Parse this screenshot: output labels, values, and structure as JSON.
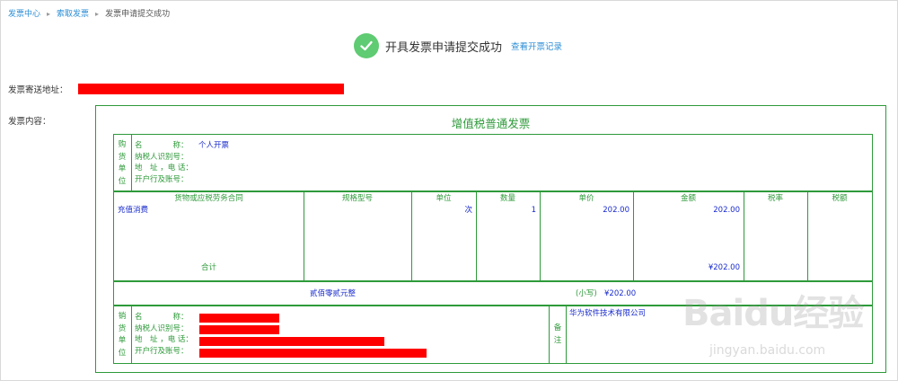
{
  "breadcrumb": [
    "发票中心",
    "索取发票",
    "发票申请提交成功"
  ],
  "success": {
    "message": "开具发票申请提交成功",
    "view_link": "查看开票记录",
    "icon": "check-icon",
    "icon_color": "#5fcb72"
  },
  "address_label": "发票寄送地址：",
  "content_label": "发票内容：",
  "invoice": {
    "title": "增值税普通发票",
    "buyer": {
      "side_label": [
        "购",
        "货",
        "单",
        "位"
      ],
      "fields": [
        {
          "label": "名　　　　称：",
          "value": "个人开票"
        },
        {
          "label": "纳税人识别号：",
          "value": ""
        },
        {
          "label": "地　址 ，电 话：",
          "value": ""
        },
        {
          "label": "开户行及账号：",
          "value": ""
        }
      ]
    },
    "items": {
      "headers": [
        "货物或应税劳务合同",
        "规格型号",
        "单位",
        "数量",
        "单价",
        "金额",
        "税率",
        "税额"
      ],
      "rows": [
        {
          "name": "充值消费",
          "spec": "",
          "unit": "次",
          "qty": "1",
          "price": "202.00",
          "amount": "202.00",
          "rate": "",
          "tax": ""
        }
      ],
      "total_label": "合计",
      "total_amount": "¥202.00"
    },
    "summary": {
      "amount_in_words": "贰佰零贰元整",
      "small_label": "(小写)",
      "small_amount": "¥202.00"
    },
    "seller": {
      "side_label": [
        "销",
        "货",
        "单",
        "位"
      ],
      "fields": [
        {
          "label": "名　　　　称："
        },
        {
          "label": "纳税人识别号："
        },
        {
          "label": "地　址 ，电 话："
        },
        {
          "label": "开户行及账号："
        }
      ],
      "remark_label": [
        "备",
        "注"
      ],
      "remark": "华为软件技术有限公司"
    }
  },
  "watermark": {
    "brand": "Baidu经验",
    "url": "jingyan.baidu.com"
  },
  "colors": {
    "link": "#2c8ed6",
    "invoice_green": "#2e9a3a",
    "invoice_blue": "#1a2ccc",
    "redaction": "#ff0000"
  }
}
